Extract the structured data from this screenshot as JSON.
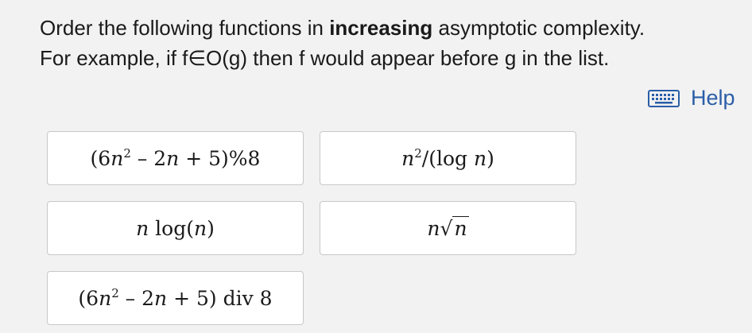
{
  "prompt": {
    "line1_before": "Order the following functions in ",
    "line1_bold": "increasing",
    "line1_after": " asymptotic complexity.",
    "line2": "For example, if f∈O(g) then f would appear before g in the list."
  },
  "help": {
    "label": "Help",
    "icon": "keyboard-icon"
  },
  "items": [
    {
      "parts": [
        "(6",
        "n",
        "2",
        " – 2",
        "n",
        " + 5)%8"
      ]
    },
    {
      "parts": [
        "n",
        "2",
        "/(log ",
        "n",
        ")"
      ]
    },
    {
      "parts": [
        "n",
        " log(",
        "n",
        ")"
      ]
    },
    {
      "parts": [
        "n",
        "√",
        "n"
      ]
    },
    {
      "parts": [
        "(6",
        "n",
        "2",
        " – 2",
        "n",
        " + 5) div 8"
      ]
    }
  ],
  "colors": {
    "background": "#f2f2f2",
    "card": "#ffffff",
    "link": "#2a5ea8"
  }
}
